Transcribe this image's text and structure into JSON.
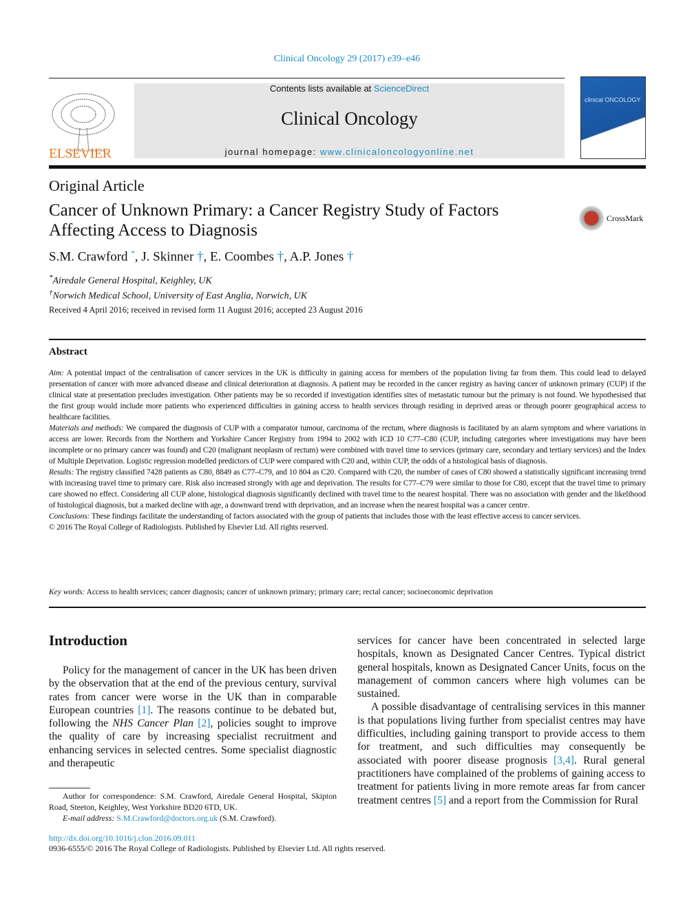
{
  "header": {
    "citation": "Clinical Oncology 29 (2017) e39–e46",
    "publisher_logo": "ELSEVIER",
    "contents_prefix": "Contents lists available at ",
    "contents_link": "ScienceDirect",
    "journal_title": "Clinical Oncology",
    "homepage_prefix": "journal homepage: ",
    "homepage_link": "www.clinicaloncologyonline.net",
    "cover_text": "clinical ONCOLOGY"
  },
  "article": {
    "type": "Original Article",
    "title": "Cancer of Unknown Primary: a Cancer Registry Study of Factors Affecting Access to Diagnosis",
    "crossmark": "CrossMark",
    "authors": [
      {
        "name": "S.M. Crawford",
        "mark": "*"
      },
      {
        "name": "J. Skinner",
        "mark": "†"
      },
      {
        "name": "E. Coombes",
        "mark": "†"
      },
      {
        "name": "A.P. Jones",
        "mark": "†"
      }
    ],
    "affiliations": [
      {
        "mark": "*",
        "text": "Airedale General Hospital, Keighley, UK"
      },
      {
        "mark": "†",
        "text": "Norwich Medical School, University of East Anglia, Norwich, UK"
      }
    ],
    "received": "Received 4 April 2016; received in revised form 11 August 2016; accepted 23 August 2016"
  },
  "abstract": {
    "heading": "Abstract",
    "aim_label": "Aim:",
    "aim": " A potential impact of the centralisation of cancer services in the UK is difficulty in gaining access for members of the population living far from them. This could lead to delayed presentation of cancer with more advanced disease and clinical deterioration at diagnosis. A patient may be recorded in the cancer registry as having cancer of unknown primary (CUP) if the clinical state at presentation precludes investigation. Other patients may be so recorded if investigation identifies sites of metastatic tumour but the primary is not found. We hypothesised that the first group would include more patients who experienced difficulties in gaining access to health services through residing in deprived areas or through poorer geographical access to healthcare facilities.",
    "methods_label": "Materials and methods:",
    "methods": " We compared the diagnosis of CUP with a comparator tumour, carcinoma of the rectum, where diagnosis is facilitated by an alarm symptom and where variations in access are lower. Records from the Northern and Yorkshire Cancer Registry from 1994 to 2002 with ICD 10 C77–C80 (CUP, including categories where investigations may have been incomplete or no primary cancer was found) and C20 (malignant neoplasm of rectum) were combined with travel time to services (primary care, secondary and tertiary services) and the Index of Multiple Deprivation. Logistic regression modelled predictors of CUP were compared with C20 and, within CUP, the odds of a histological basis of diagnosis.",
    "results_label": "Results:",
    "results": " The registry classified 7428 patients as C80, 8849 as C77–C79, and 10 804 as C20. Compared with C20, the number of cases of C80 showed a statistically significant increasing trend with increasing travel time to primary care. Risk also increased strongly with age and deprivation. The results for C77–C79 were similar to those for C80, except that the travel time to primary care showed no effect. Considering all CUP alone, histological diagnosis significantly declined with travel time to the nearest hospital. There was no association with gender and the likelihood of histological diagnosis, but a marked decline with age, a downward trend with deprivation, and an increase when the nearest hospital was a cancer centre.",
    "conclusions_label": "Conclusions:",
    "conclusions": " These findings facilitate the understanding of factors associated with the group of patients that includes those with the least effective access to cancer services.",
    "copyright": "© 2016 The Royal College of Radiologists. Published by Elsevier Ltd. All rights reserved.",
    "keywords_label": "Key words:",
    "keywords": " Access to health services; cancer diagnosis; cancer of unknown primary; primary care; rectal cancer; socioeconomic deprivation"
  },
  "body": {
    "intro_heading": "Introduction",
    "col1": {
      "t1": "Policy for the management of cancer in the UK has been driven by the observation that at the end of the previous century, survival rates from cancer were worse in the UK than in comparable European countries ",
      "ref1": "[1]",
      "t2": ". The reasons continue to be debated but, following the ",
      "plan": "NHS Cancer Plan",
      "t3": " ",
      "ref2": "[2]",
      "t4": ", policies sought to improve the quality of care by increasing specialist recruitment and enhancing services in selected centres. Some specialist diagnostic and therapeutic"
    },
    "col2": {
      "p1": "services for cancer have been concentrated in selected large hospitals, known as Designated Cancer Centres. Typical district general hospitals, known as Designated Cancer Units, focus on the management of common cancers where high volumes can be sustained.",
      "p2a": "A possible disadvantage of centralising services in this manner is that populations living further from specialist centres may have difficulties, including gaining transport to provide access to them for treatment, and such difficulties may consequently be associated with poorer disease prognosis ",
      "ref34": "[3,4]",
      "p2b": ". Rural general practitioners have complained of the problems of gaining access to treatment for patients living in more remote areas far from cancer treatment centres ",
      "ref5": "[5]",
      "p2c": " and a report from the Commission for Rural"
    },
    "footnote": {
      "text": "Author for correspondence: S.M. Crawford, Airedale General Hospital, Skipton Road, Steeton, Keighley, West Yorkshire BD20 6TD, UK.",
      "email_label": "E-mail address:",
      "email": "S.M.Crawford@doctors.org.uk",
      "email_suffix": " (S.M. Crawford)."
    },
    "doi": "http://dx.doi.org/10.1016/j.clon.2016.09.011",
    "issn": "0936-6555/© 2016 The Royal College of Radiologists. Published by Elsevier Ltd. All rights reserved."
  }
}
